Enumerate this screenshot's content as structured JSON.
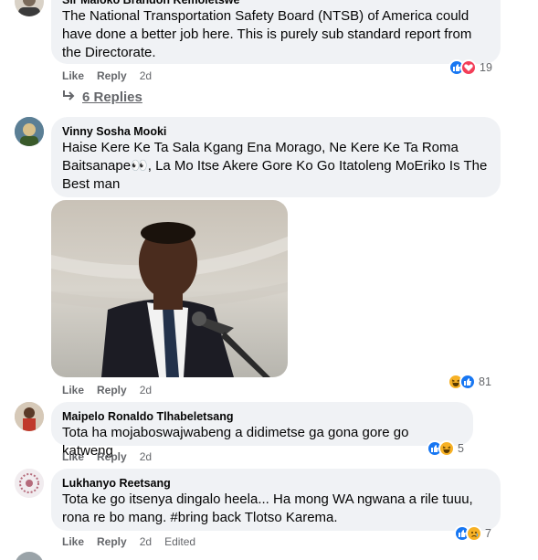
{
  "comments": [
    {
      "author": "Sir Maloko Brandon Kemoietswe",
      "text": "The National Transportation Safety Board (NTSB) of America could have done a better job here. This is purely sub standard report from the Directorate.",
      "like_label": "Like",
      "reply_label": "Reply",
      "time": "2d",
      "reactions": [
        "like",
        "love"
      ],
      "reaction_count": "19",
      "replies_label": "6 Replies"
    },
    {
      "author": "Vinny Sosha Mooki",
      "text_line1": "Haise Kere Ke Ta Sala Kgang Ena Morago, Ne Kere Ke Ta Roma",
      "text_line2": "Baitsanape👀, La Mo Itse Akere Gore Ko Go Itatoleng MoEriko Is The",
      "text_line3": "Best man",
      "like_label": "Like",
      "reply_label": "Reply",
      "time": "2d",
      "reactions": [
        "haha",
        "like"
      ],
      "reaction_count": "81"
    },
    {
      "author": "Maipelo Ronaldo Tlhabeletsang",
      "text": "Tota ha mojaboswajwabeng a didimetse ga gona gore go katweng",
      "like_label": "Like",
      "reply_label": "Reply",
      "time": "2d",
      "reactions": [
        "like",
        "haha"
      ],
      "reaction_count": "5"
    },
    {
      "author": "Lukhanyo Reetsang",
      "text_line1": "Tota ke go itsenya dingalo heela... Ha mong WA ngwana a rile tuuu,",
      "text_line2": "rona re bo mang. #bring back Tlotso Karema.",
      "like_label": "Like",
      "reply_label": "Reply",
      "time": "2d",
      "edited": "Edited",
      "reactions": [
        "like",
        "sad"
      ],
      "reaction_count": "7"
    }
  ],
  "colors": {
    "bubble": "#f0f2f5",
    "secondary_text": "#65676b",
    "like_blue": "#1877f2",
    "love_red": "#f33e58",
    "haha_yellow": "#f7b125"
  }
}
